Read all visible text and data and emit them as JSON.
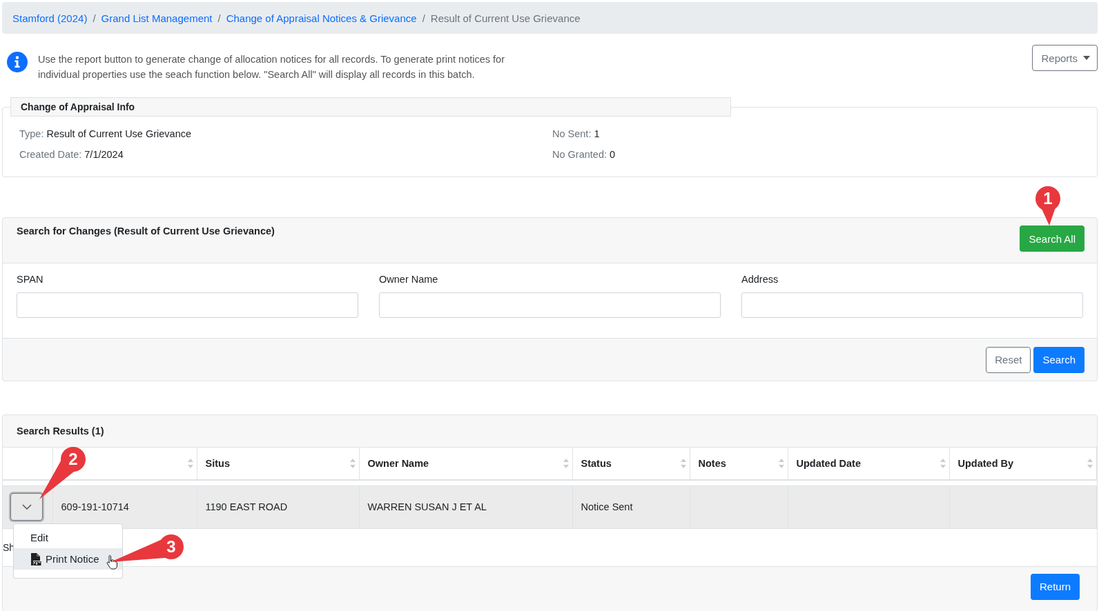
{
  "breadcrumb": [
    {
      "label": "Stamford (2024)",
      "link": true
    },
    {
      "separator": "/",
      "label": "Grand List Management",
      "link": true
    },
    {
      "separator": "/",
      "label": "Change of Appraisal Notices & Grievance",
      "link": true
    },
    {
      "separator": "/",
      "label": "Result of Current Use Grievance",
      "link": false
    }
  ],
  "info": {
    "text": "Use the report button to generate change of allocation notices for all records. To generate print notices for individual properties use the seach function below. \"Search All\" will display all records in this batch."
  },
  "reports_button": {
    "label": "Reports"
  },
  "appraisal_info": {
    "title": "Change of Appraisal Info",
    "fields": [
      {
        "label": "Type:",
        "value": "Result of Current Use Grievance"
      },
      {
        "label": "No Sent:",
        "value": "1"
      },
      {
        "label": "Created Date:",
        "value": "7/1/2024"
      },
      {
        "label": "No Granted:",
        "value": "0"
      }
    ]
  },
  "search_panel": {
    "title": "Search for Changes (Result of Current Use Grievance)",
    "search_all_button": "Search All",
    "fields": [
      {
        "label": "SPAN"
      },
      {
        "label": "Owner Name"
      },
      {
        "label": "Address"
      }
    ],
    "buttons": [
      {
        "label": "Reset",
        "kind": "secondary"
      },
      {
        "label": "Search",
        "kind": "primary"
      }
    ]
  },
  "results": {
    "title": "Search Results (1)",
    "columns": [
      {
        "sortable": true
      },
      {
        "label": "Situs",
        "sortable": true
      },
      {
        "label": "Owner Name",
        "sortable": true
      },
      {
        "label": "Status",
        "sortable": true
      },
      {
        "label": "Notes",
        "sortable": true
      },
      {
        "label": "Updated Date",
        "sortable": true
      },
      {
        "label": "Updated By",
        "sortable": true
      }
    ],
    "rows": [
      {
        "cells": [
          "609-191-10714",
          "1190 EAST ROAD",
          "WARREN SUSAN J ET AL",
          "Notice Sent"
        ]
      }
    ],
    "footer_text": "Sh",
    "menu": {
      "expanded": true,
      "items": [
        {
          "label": "Edit",
          "icon": false,
          "selected": false
        },
        {
          "label": "Print Notice",
          "icon": true,
          "selected": true
        }
      ]
    },
    "return_button": "Return"
  },
  "callouts": [
    "1",
    "2",
    "3"
  ]
}
